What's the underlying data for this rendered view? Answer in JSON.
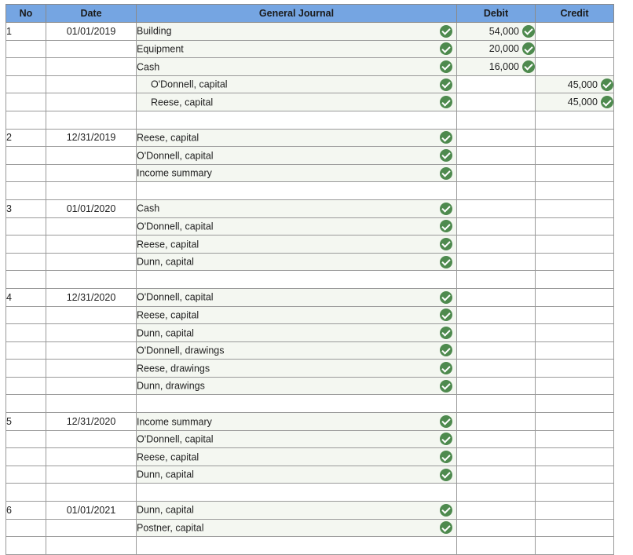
{
  "headers": {
    "no": "No",
    "date": "Date",
    "journal": "General Journal",
    "debit": "Debit",
    "credit": "Credit"
  },
  "colors": {
    "header_bg": "#75a5e2",
    "check": "#4e8a4e",
    "account_bg": "#f4f7f1"
  },
  "entries": [
    {
      "no": "1",
      "date": "01/01/2019",
      "lines": [
        {
          "account": "Building",
          "debit": "54,000",
          "credit": ""
        },
        {
          "account": "Equipment",
          "debit": "20,000",
          "credit": ""
        },
        {
          "account": "Cash",
          "debit": "16,000",
          "credit": ""
        },
        {
          "account": "O'Donnell, capital",
          "debit": "",
          "credit": "45,000",
          "indent": true
        },
        {
          "account": "Reese, capital",
          "debit": "",
          "credit": "45,000",
          "indent": true
        }
      ]
    },
    {
      "no": "2",
      "date": "12/31/2019",
      "lines": [
        {
          "account": "Reese, capital",
          "debit": "",
          "credit": ""
        },
        {
          "account": "O'Donnell, capital",
          "debit": "",
          "credit": ""
        },
        {
          "account": "Income summary",
          "debit": "",
          "credit": ""
        }
      ]
    },
    {
      "no": "3",
      "date": "01/01/2020",
      "lines": [
        {
          "account": "Cash",
          "debit": "",
          "credit": ""
        },
        {
          "account": "O'Donnell, capital",
          "debit": "",
          "credit": ""
        },
        {
          "account": "Reese, capital",
          "debit": "",
          "credit": ""
        },
        {
          "account": "Dunn, capital",
          "debit": "",
          "credit": ""
        }
      ]
    },
    {
      "no": "4",
      "date": "12/31/2020",
      "lines": [
        {
          "account": "O'Donnell, capital",
          "debit": "",
          "credit": ""
        },
        {
          "account": "Reese, capital",
          "debit": "",
          "credit": ""
        },
        {
          "account": "Dunn, capital",
          "debit": "",
          "credit": ""
        },
        {
          "account": "O'Donnell, drawings",
          "debit": "",
          "credit": ""
        },
        {
          "account": "Reese, drawings",
          "debit": "",
          "credit": ""
        },
        {
          "account": "Dunn, drawings",
          "debit": "",
          "credit": ""
        }
      ]
    },
    {
      "no": "5",
      "date": "12/31/2020",
      "lines": [
        {
          "account": "Income summary",
          "debit": "",
          "credit": ""
        },
        {
          "account": "O'Donnell, capital",
          "debit": "",
          "credit": ""
        },
        {
          "account": "Reese, capital",
          "debit": "",
          "credit": ""
        },
        {
          "account": "Dunn, capital",
          "debit": "",
          "credit": ""
        }
      ]
    },
    {
      "no": "6",
      "date": "01/01/2021",
      "lines": [
        {
          "account": "Dunn, capital",
          "debit": "",
          "credit": ""
        },
        {
          "account": "Postner, capital",
          "debit": "",
          "credit": ""
        }
      ]
    }
  ]
}
